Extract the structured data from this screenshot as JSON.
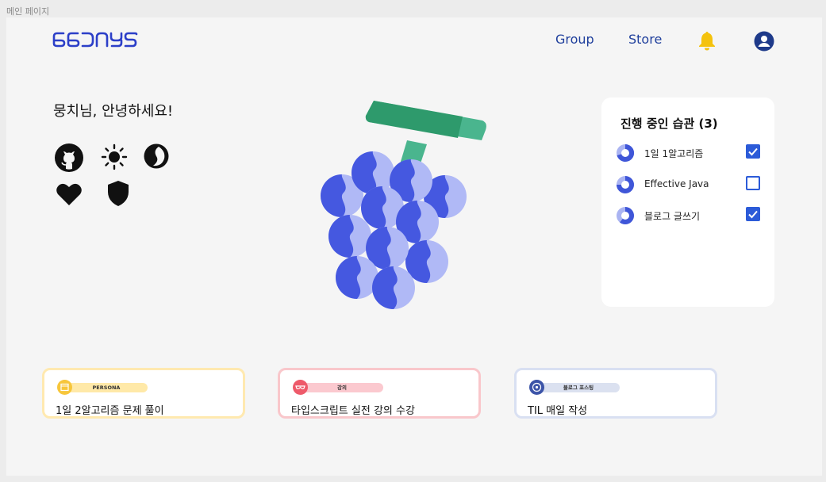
{
  "frame_label": "메인 페이지",
  "logo": {
    "text": "66DAYS"
  },
  "nav": {
    "group": "Group",
    "store": "Store",
    "bell_icon": "bell-icon",
    "user_icon": "user-icon"
  },
  "greeting": "뭉치님, 안녕하세요!",
  "badges": [
    "github-icon",
    "sun-icon",
    "moon-icon",
    "heart-icon",
    "shield-icon"
  ],
  "habits": {
    "title": "진행 중인 습관 (3)",
    "items": [
      {
        "name": "1일 1알고리즘",
        "checked": true
      },
      {
        "name": "Effective Java",
        "checked": false
      },
      {
        "name": "블로그 글쓰기",
        "checked": true
      }
    ]
  },
  "tasks": [
    {
      "tag": "PERSONA",
      "text": "1일 2알고리즘 문제 풀이",
      "icon": "calendar-icon",
      "color": "#ffe28a"
    },
    {
      "tag": "강의",
      "text": "타입스크립트 실전 강의 수강",
      "icon": "glasses-icon",
      "color": "#f9c0c6"
    },
    {
      "tag": "블로그 포스팅",
      "text": "TIL 매일 작성",
      "icon": "target-icon",
      "color": "#d6def0"
    }
  ],
  "colors": {
    "grape_dark": "#4558e0",
    "grape_light": "#b0b9f6",
    "stem": "#2e9a6c",
    "nav_blue": "#1f3f9c",
    "bell": "#f4c20d",
    "check": "#2c5bd8"
  }
}
